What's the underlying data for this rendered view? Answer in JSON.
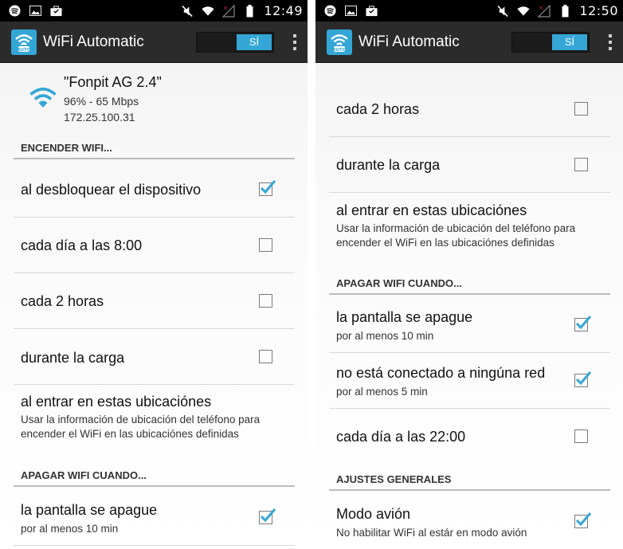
{
  "colors": {
    "accent": "#33a6d6",
    "action_bar": "#2b2b2b",
    "status_bar": "#000000"
  },
  "screens": [
    {
      "status": {
        "time": "12:49",
        "icons": [
          "spotify-icon",
          "image-icon",
          "briefcase-icon",
          "mute-icon",
          "wifi-signal-icon",
          "no-signal-icon",
          "battery-icon"
        ]
      },
      "app_bar": {
        "title": "WiFi Automatic",
        "toggle_label": "SÍ",
        "icon": "wifi-automatic-app-icon"
      },
      "network": {
        "name": "\"Fonpit AG 2.4\"",
        "speed": "96% - 65 Mbps",
        "ip": "172.25.100.31"
      },
      "sections": [
        {
          "header": "ENCENDER WIFI..."
        },
        {
          "header": "APAGAR WIFI CUANDO..."
        }
      ],
      "rows": [
        {
          "label": "al desbloquear el dispositivo",
          "checked": true
        },
        {
          "label": "cada día a las 8:00",
          "checked": false
        },
        {
          "label": "cada 2 horas",
          "checked": false
        },
        {
          "label": "durante la carga",
          "checked": false
        },
        {
          "label": "al entrar en estas ubicaciónes",
          "sub": "Usar la información de ubicación del teléfono para encender el WiFi en las ubicaciónes definidas"
        },
        {
          "label": "la pantalla se apague",
          "sub": "por al menos 10 min",
          "checked": true
        }
      ]
    },
    {
      "status": {
        "time": "12:50",
        "icons": [
          "spotify-icon",
          "image-icon",
          "briefcase-icon",
          "mute-icon",
          "wifi-signal-icon",
          "no-signal-icon",
          "battery-icon"
        ]
      },
      "app_bar": {
        "title": "WiFi Automatic",
        "toggle_label": "SÍ",
        "icon": "wifi-automatic-app-icon"
      },
      "sections": [
        {
          "header": "APAGAR WIFI CUANDO..."
        },
        {
          "header": "AJUSTES GENERALES"
        }
      ],
      "rows": [
        {
          "label": "cada 2 horas",
          "checked": false
        },
        {
          "label": "durante la carga",
          "checked": false
        },
        {
          "label": "al entrar en estas ubicaciónes",
          "sub": "Usar la información de ubicación del teléfono para encender el WiFi en las ubicaciónes definidas"
        },
        {
          "label": "la pantalla se apague",
          "sub": "por al menos 10 min",
          "checked": true
        },
        {
          "label": "no está conectado a ningúna red",
          "sub": "por al menos 5 min",
          "checked": true
        },
        {
          "label": "cada día a las 22:00",
          "checked": false
        },
        {
          "label": "Modo avión",
          "sub": "No habilitar WiFi al estár en modo avión",
          "checked": true
        }
      ]
    }
  ]
}
